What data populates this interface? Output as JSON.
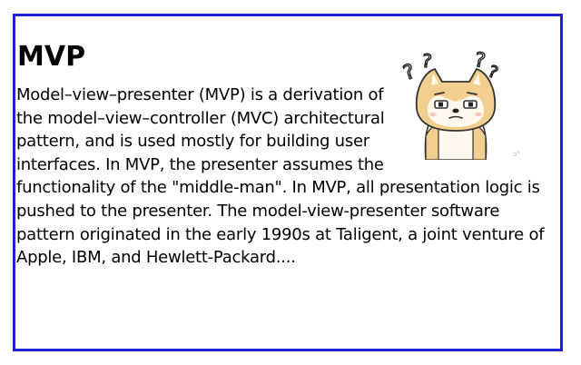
{
  "article": {
    "title": "MVP",
    "body": "Model–view–presenter (MVP) is a derivation of the model–view–controller (MVC) architectural pattern, and is used mostly for building user interfaces. In MVP, the presenter assumes the functionality of the \"middle-man\". In MVP, all presentation logic is pushed to the presenter. The model-view-presenter software pattern originated in the early 1990s at Taligent, a joint venture of Apple, IBM, and Hewlett-Packard....",
    "image": {
      "icon": "confused-shiba-dog-icon",
      "watermark": "o°"
    }
  },
  "colors": {
    "border": "#1f1fd6",
    "text": "#000000",
    "dog_fur": "#f3cf8f",
    "dog_face": "#fff8ec"
  }
}
